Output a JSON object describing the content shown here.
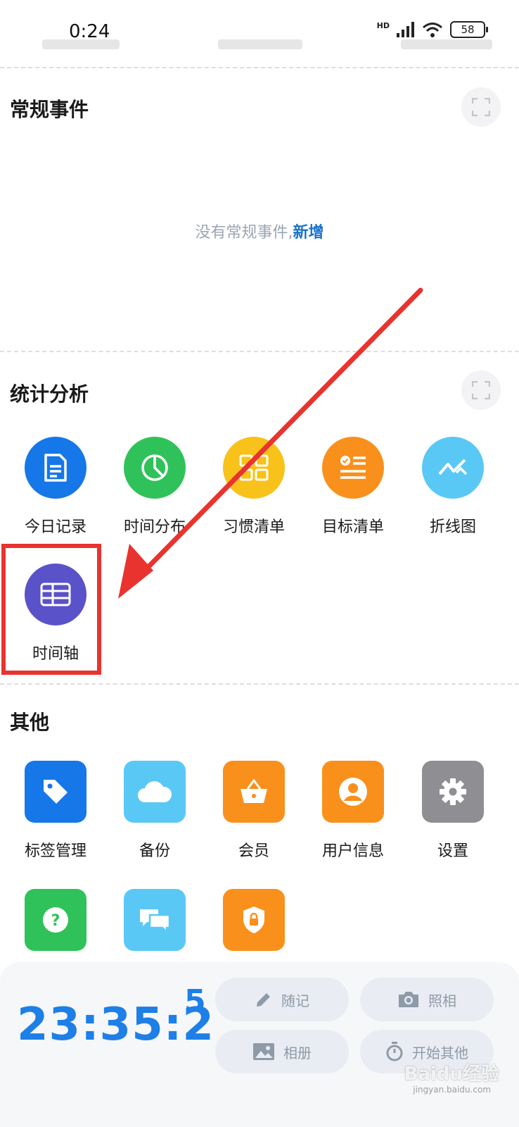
{
  "status_bar": {
    "time": "0:24",
    "network": "HD",
    "battery": "58"
  },
  "sections": {
    "regular": {
      "title": "常规事件",
      "empty_text": "没有常规事件,",
      "empty_link": "新增"
    },
    "stats": {
      "title": "统计分析",
      "items": [
        {
          "label": "今日记录",
          "color": "#1677e8",
          "icon": "document-icon"
        },
        {
          "label": "时间分布",
          "color": "#30c25a",
          "icon": "pie-chart-icon"
        },
        {
          "label": "习惯清单",
          "color": "#f8c21a",
          "icon": "grid-icon"
        },
        {
          "label": "目标清单",
          "color": "#f9901c",
          "icon": "checklist-icon"
        },
        {
          "label": "折线图",
          "color": "#5ac8f5",
          "icon": "line-chart-icon"
        },
        {
          "label": "时间轴",
          "color": "#5a52c8",
          "icon": "table-icon"
        }
      ]
    },
    "other": {
      "title": "其他",
      "items": [
        {
          "label": "标签管理",
          "color": "#1677e8",
          "icon": "tag-icon"
        },
        {
          "label": "备份",
          "color": "#5ac8f5",
          "icon": "cloud-icon"
        },
        {
          "label": "会员",
          "color": "#f9901c",
          "icon": "basket-icon"
        },
        {
          "label": "用户信息",
          "color": "#f9901c",
          "icon": "user-icon"
        },
        {
          "label": "设置",
          "color": "#8e8e93",
          "icon": "gear-icon"
        },
        {
          "label": "",
          "color": "#30c25a",
          "icon": "help-icon"
        },
        {
          "label": "",
          "color": "#5ac8f5",
          "icon": "chat-icon"
        },
        {
          "label": "",
          "color": "#f9901c",
          "icon": "shield-lock-icon"
        }
      ]
    }
  },
  "bottom": {
    "clock": "23:35:2",
    "clock_sup": "5",
    "buttons": {
      "note": "随记",
      "photo": "照相",
      "album": "相册",
      "start_other": "开始其他"
    }
  },
  "watermark": {
    "text": "Baidu经验",
    "sub": "jingyan.baidu.com"
  }
}
